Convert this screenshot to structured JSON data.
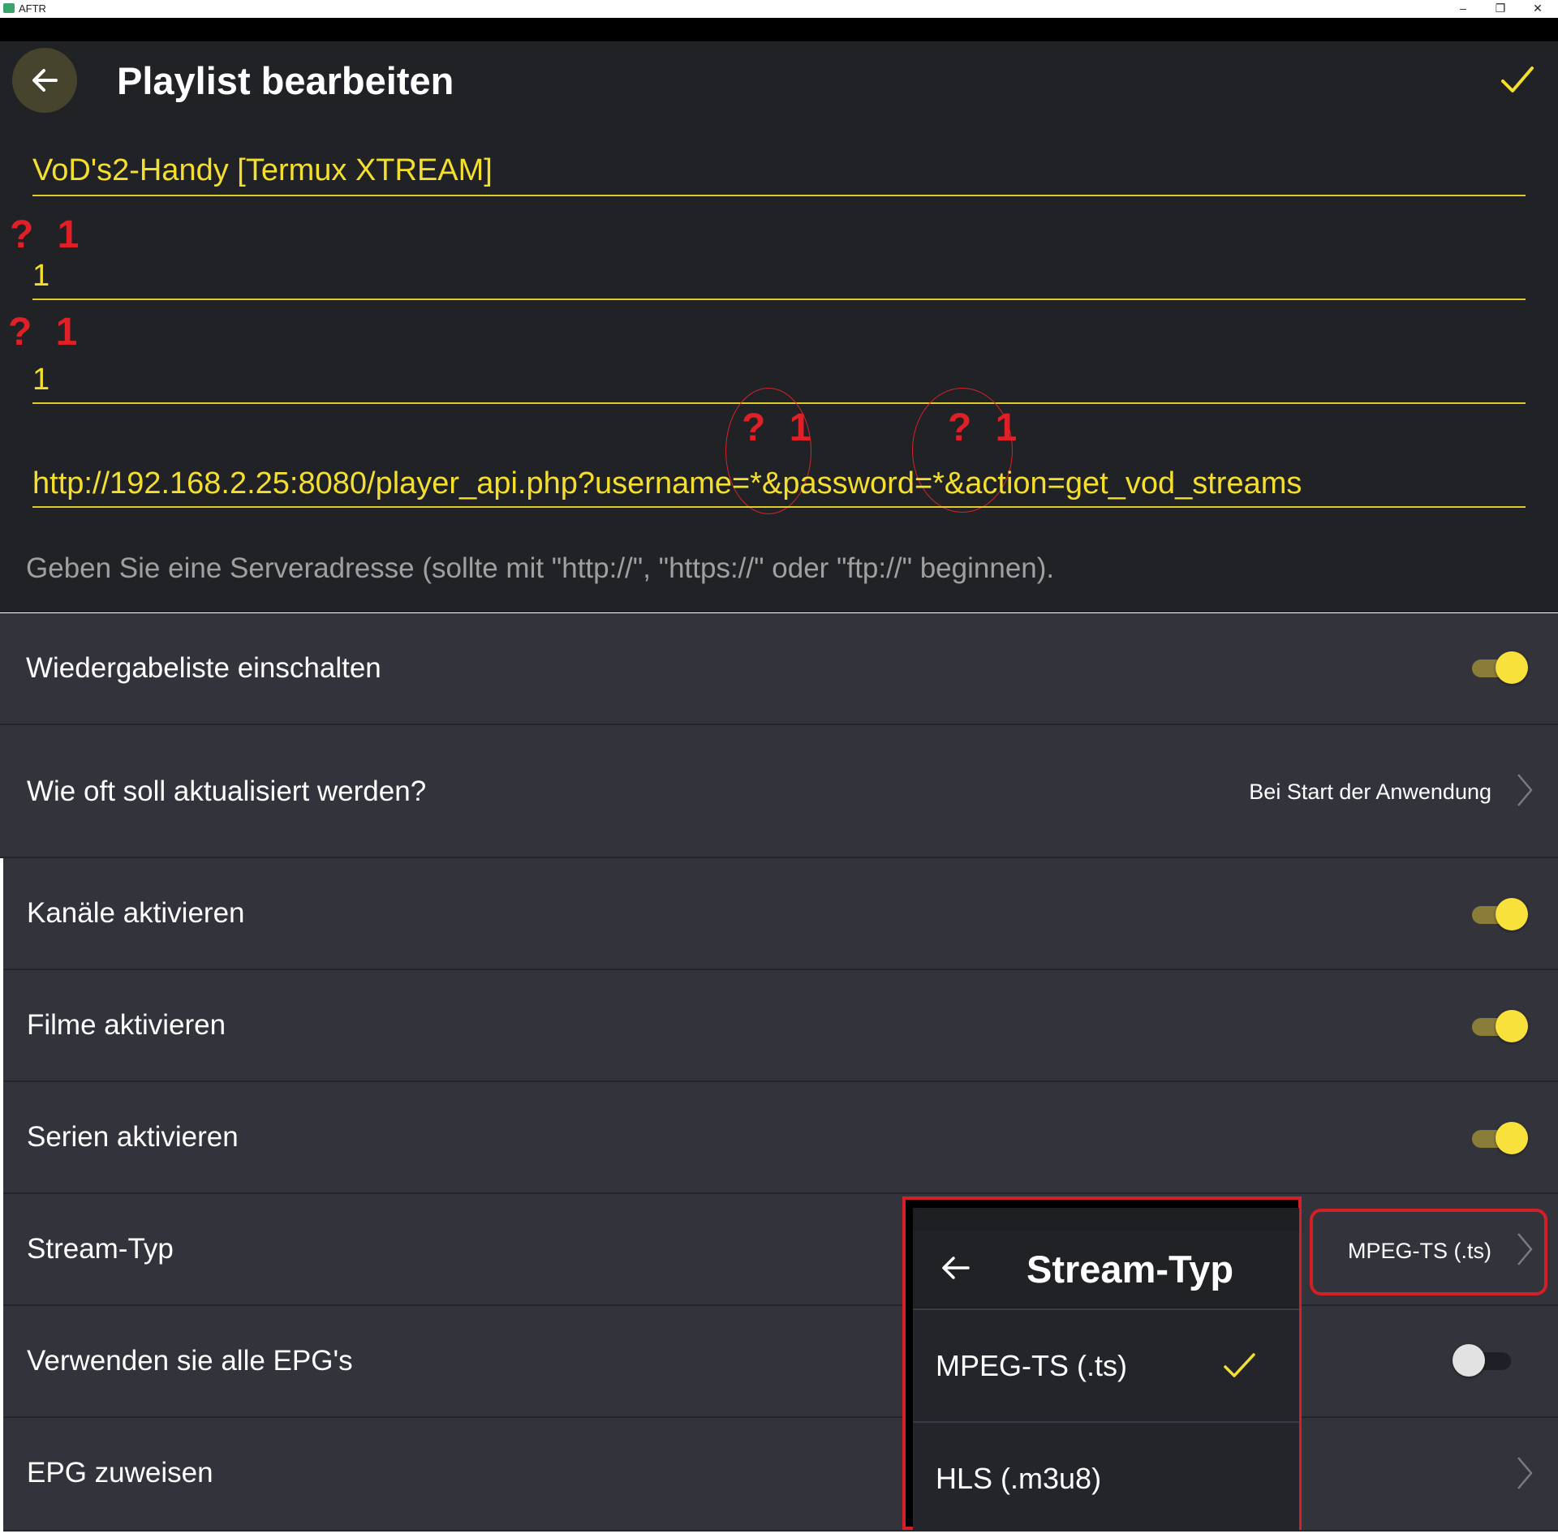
{
  "window": {
    "title": "AFTR",
    "minimize_label": "–",
    "maximize_label": "❐",
    "close_label": "✕"
  },
  "header": {
    "title": "Playlist bearbeiten",
    "back_icon": "arrow-left-icon",
    "confirm_icon": "checkmark-icon"
  },
  "form": {
    "name_value": "VoD's2-Handy [Termux XTREAM]",
    "username_value": "1",
    "password_value": "1",
    "url_value": "http://192.168.2.25:8080/player_api.php?username=*&password=*&action=get_vod_streams",
    "hint": "Geben Sie eine Serveradresse (sollte mit \"http://\", \"https://\" oder \"ftp://\" beginnen)."
  },
  "annotations": {
    "username_mark": "? 1",
    "password_mark": "? 1",
    "url_username_mark": "? 1",
    "url_password_mark": "? 1"
  },
  "settings": [
    {
      "label": "Wiedergabeliste einschalten",
      "toggle": true
    },
    {
      "label": "Wie oft soll aktualisiert werden?",
      "value": "Bei Start der Anwendung"
    },
    {
      "label": "Kanäle aktivieren",
      "toggle": true
    },
    {
      "label": "Filme aktivieren",
      "toggle": true
    },
    {
      "label": "Serien aktivieren",
      "toggle": true
    },
    {
      "label": "Stream-Typ",
      "value": "MPEG-TS (.ts)"
    },
    {
      "label": "Verwenden sie alle EPG's",
      "toggle": false
    },
    {
      "label": "EPG zuweisen"
    }
  ],
  "popup": {
    "title": "Stream-Typ",
    "options": [
      {
        "label": "MPEG-TS (.ts)",
        "selected": true
      },
      {
        "label": "HLS (.m3u8)",
        "selected": false
      }
    ]
  },
  "colors": {
    "accent": "#f5df2e",
    "background": "#212226",
    "row_background": "#32333b",
    "annotation_red": "#e01f26"
  }
}
